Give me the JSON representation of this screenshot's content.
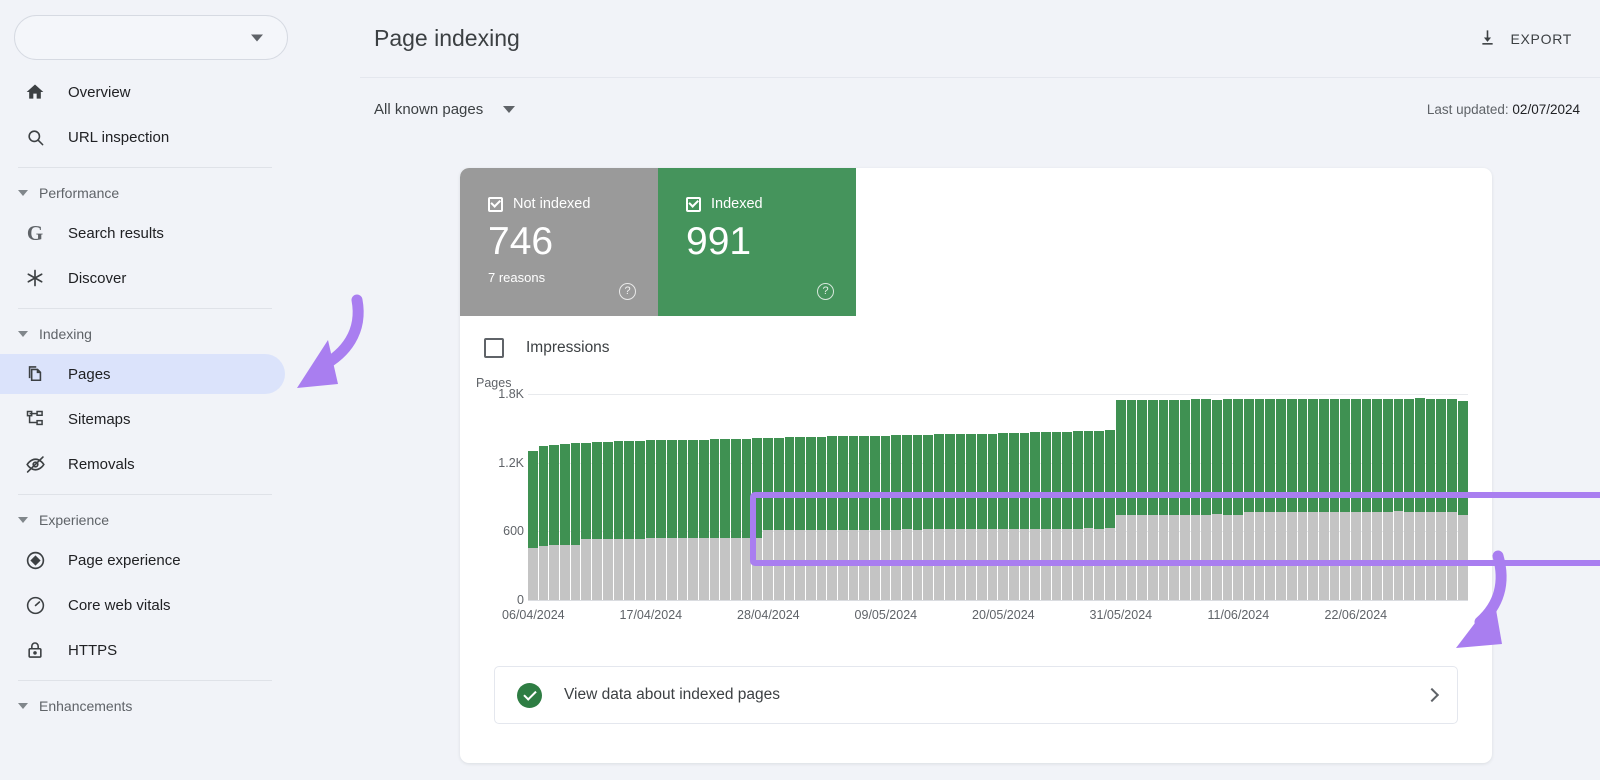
{
  "sidebar": {
    "property_selector": {
      "name": "property-selector",
      "value": "",
      "caret": "chevron-down-icon"
    },
    "items_top": [
      {
        "label": "Overview",
        "icon": "home-icon",
        "active": false
      },
      {
        "label": "URL inspection",
        "icon": "search-icon",
        "active": false
      }
    ],
    "sections": [
      {
        "label": "Performance",
        "items": [
          {
            "label": "Search results",
            "icon": "google-g-icon",
            "active": false
          },
          {
            "label": "Discover",
            "icon": "asterisk-icon",
            "active": false
          }
        ]
      },
      {
        "label": "Indexing",
        "items": [
          {
            "label": "Pages",
            "icon": "pages-icon",
            "active": true
          },
          {
            "label": "Sitemaps",
            "icon": "sitemap-icon",
            "active": false
          },
          {
            "label": "Removals",
            "icon": "eye-off-icon",
            "active": false
          }
        ]
      },
      {
        "label": "Experience",
        "items": [
          {
            "label": "Page experience",
            "icon": "diamond-icon",
            "active": false
          },
          {
            "label": "Core web vitals",
            "icon": "gauge-icon",
            "active": false
          },
          {
            "label": "HTTPS",
            "icon": "lock-icon",
            "active": false
          }
        ]
      }
    ],
    "section_last": {
      "label": "Enhancements"
    }
  },
  "header": {
    "title": "Page indexing",
    "export_label": "EXPORT",
    "export_icon": "download-icon"
  },
  "subheader": {
    "filter_label": "All known pages",
    "filter_icon": "chevron-down-icon",
    "last_updated_prefix": "Last updated: ",
    "last_updated_date": "02/07/2024"
  },
  "stats": [
    {
      "label": "Not indexed",
      "value": "746",
      "sub": "7 reasons",
      "color": "#9a9a9a",
      "checked": true,
      "help_icon": "help-circle-icon"
    },
    {
      "label": "Indexed",
      "value": "991",
      "sub": "",
      "color": "#45945c",
      "checked": true,
      "help_icon": "help-circle-icon"
    }
  ],
  "impressions_toggle": {
    "label": "Impressions",
    "checked": false
  },
  "chart_data": {
    "type": "bar",
    "stacked": true,
    "title": "",
    "ylabel": "Pages",
    "xlabel": "",
    "ylim": [
      0,
      1800
    ],
    "yticks": [
      0,
      600,
      1200,
      1800
    ],
    "ytick_labels": [
      "0",
      "600",
      "1.2K",
      "1.8K"
    ],
    "grid": true,
    "legend_position": "top-cards",
    "xtick_labels": [
      "06/04/2024",
      "17/04/2024",
      "28/04/2024",
      "09/05/2024",
      "20/05/2024",
      "31/05/2024",
      "11/06/2024",
      "22/06/2024"
    ],
    "xtick_indices": [
      0,
      11,
      22,
      33,
      44,
      55,
      66,
      77
    ],
    "series": [
      {
        "name": "Not indexed",
        "color": "#c4c4c4",
        "values": [
          455,
          470,
          478,
          480,
          482,
          530,
          533,
          535,
          534,
          537,
          536,
          538,
          540,
          541,
          539,
          540,
          542,
          541,
          540,
          543,
          545,
          546,
          610,
          612,
          611,
          613,
          614,
          612,
          615,
          614,
          616,
          613,
          612,
          614,
          615,
          617,
          616,
          618,
          617,
          619,
          620,
          618,
          621,
          619,
          620,
          622,
          621,
          623,
          620,
          622,
          624,
          623,
          625,
          624,
          626,
          742,
          745,
          744,
          746,
          743,
          745,
          747,
          744,
          746,
          748,
          745,
          747,
          768,
          770,
          769,
          771,
          770,
          772,
          769,
          771,
          773,
          770,
          768,
          771,
          772,
          770,
          774,
          772,
          771,
          773,
          770,
          772,
          744
        ]
      },
      {
        "name": "Indexed",
        "color": "#3f9152",
        "values": [
          845,
          872,
          880,
          884,
          886,
          840,
          845,
          848,
          852,
          851,
          855,
          856,
          858,
          857,
          862,
          861,
          860,
          863,
          866,
          864,
          865,
          867,
          805,
          808,
          812,
          810,
          813,
          816,
          814,
          818,
          817,
          822,
          824,
          823,
          826,
          825,
          828,
          827,
          830,
          829,
          832,
          835,
          833,
          836,
          838,
          837,
          840,
          842,
          846,
          845,
          848,
          850,
          852,
          855,
          858,
          1005,
          1003,
          1006,
          1004,
          1008,
          1006,
          1005,
          1009,
          1007,
          1004,
          1008,
          1006,
          985,
          983,
          986,
          984,
          987,
          985,
          988,
          986,
          984,
          988,
          990,
          987,
          986,
          989,
          985,
          988,
          990,
          987,
          989,
          986,
          991
        ]
      }
    ]
  },
  "cta": {
    "label": "View data about indexed pages",
    "status_icon": "check-circle-icon",
    "chevron_icon": "chevron-right-icon",
    "highlight_color": "#a97ef0"
  },
  "annotations": {
    "arrow_color": "#a97ef0",
    "arrow_left": "curved-arrow-pointing-to-pages-nav",
    "arrow_right": "curved-arrow-pointing-to-view-data-cta"
  }
}
